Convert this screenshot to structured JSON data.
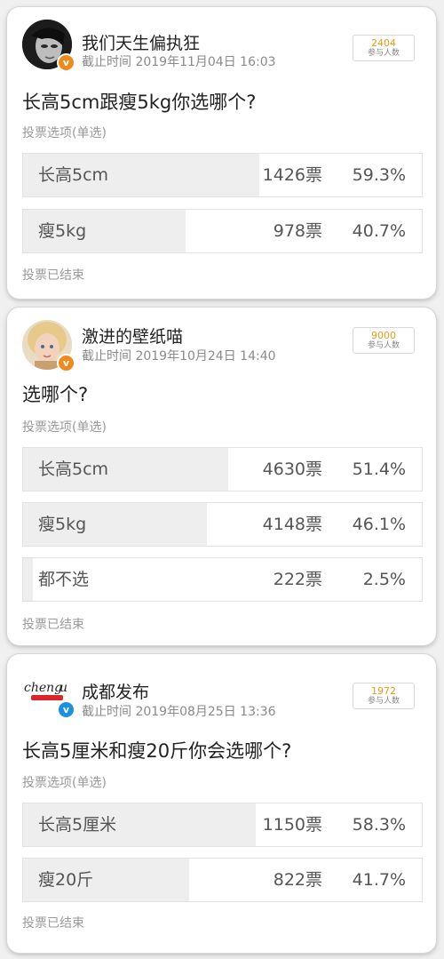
{
  "polls": [
    {
      "username": "我们天生偏执狂",
      "deadline": "截止时间 2019年11月04日 16:03",
      "participants": "2404",
      "participants_label": "参与人数",
      "question": "长高5cm跟瘦5kg你选哪个?",
      "hint": "投票选项(单选)",
      "options": [
        {
          "label": "长高5cm",
          "votes": "1426票",
          "percent": "59.3%",
          "share": 0.593
        },
        {
          "label": "瘦5kg",
          "votes": "978票",
          "percent": "40.7%",
          "share": 0.407
        }
      ],
      "ended": "投票已结束"
    },
    {
      "username": "激进的壁纸喵",
      "deadline": "截止时间 2019年10月24日 14:40",
      "participants": "9000",
      "participants_label": "参与人数",
      "question": "选哪个?",
      "hint": "投票选项(单选)",
      "options": [
        {
          "label": "长高5cm",
          "votes": "4630票",
          "percent": "51.4%",
          "share": 0.514
        },
        {
          "label": "瘦5kg",
          "votes": "4148票",
          "percent": "46.1%",
          "share": 0.461
        },
        {
          "label": "都不选",
          "votes": "222票",
          "percent": "2.5%",
          "share": 0.025
        }
      ],
      "ended": "投票已结束"
    },
    {
      "username": "成都发布",
      "deadline": "截止时间 2019年08月25日 13:36",
      "participants": "1972",
      "participants_label": "参与人数",
      "question": "长高5厘米和瘦20斤你会选哪个?",
      "hint": "投票选项(单选)",
      "options": [
        {
          "label": "长高5厘米",
          "votes": "1150票",
          "percent": "58.3%",
          "share": 0.583
        },
        {
          "label": "瘦20斤",
          "votes": "822票",
          "percent": "41.7%",
          "share": 0.417
        }
      ],
      "ended": "投票已结束"
    }
  ],
  "colors": {
    "verified_orange": "#f08a1c",
    "verified_blue": "#1a8fe3",
    "count_accent": "#e89a14",
    "bar_fill": "#eeeeee"
  },
  "icons": [
    "dark-portrait-avatar",
    "girl-portrait-avatar",
    "chengdu-logo-avatar",
    "verified-badge-icon"
  ]
}
